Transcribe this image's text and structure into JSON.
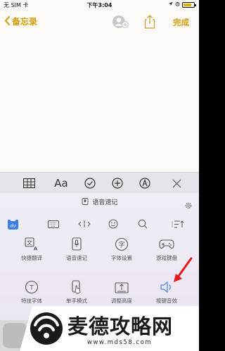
{
  "status_bar": {
    "carrier": "无 SIM 卡",
    "time": "下午3:04",
    "battery_level": 0.8,
    "battery_color": "#e0b000"
  },
  "nav": {
    "back_label": "备忘录",
    "done_label": "完成",
    "accent": "#d49a04"
  },
  "format_toolbar": {
    "text_style": "Aa",
    "icons": [
      "table-icon",
      "text-style-icon",
      "checklist-icon",
      "add-icon",
      "markup-icon",
      "close-icon"
    ]
  },
  "keyboard": {
    "header": "语音速记",
    "toolbar_icons": [
      "du-logo-icon",
      "keyboard-icon",
      "cursor-move-icon",
      "emoji-icon",
      "search-icon",
      "collapse-icon"
    ],
    "items": [
      {
        "label": "快捷翻译",
        "icon": "translate-icon"
      },
      {
        "label": "语音速记",
        "icon": "voice-note-icon"
      },
      {
        "label": "字体设置",
        "icon": "font-settings-icon"
      },
      {
        "label": "游戏键盘",
        "icon": "gamepad-icon"
      },
      {
        "label": "特技字体",
        "icon": "special-font-icon"
      },
      {
        "label": "单手模式",
        "icon": "one-hand-icon"
      },
      {
        "label": "调整高度",
        "icon": "adjust-height-icon"
      },
      {
        "label": "按键音效",
        "icon": "speaker-icon"
      }
    ]
  },
  "watermark": {
    "brand": "麦德攻略网",
    "url": "www.mds58.com"
  }
}
